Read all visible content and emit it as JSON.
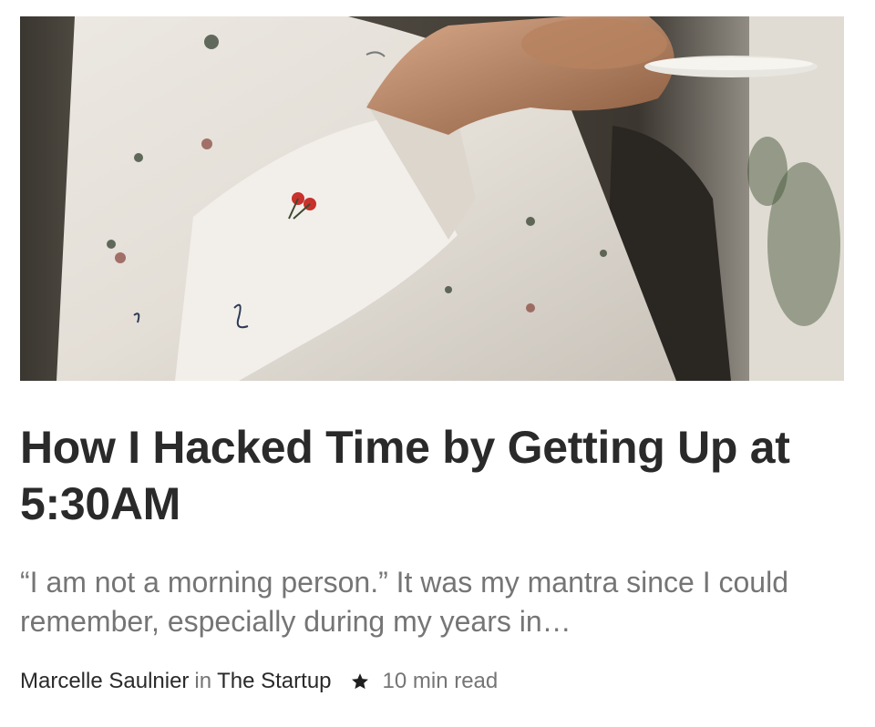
{
  "article": {
    "title": "How I Hacked Time by Getting Up at 5:30AM",
    "subtitle": "“I am not a morning person.” It was my mantra since I could remember, especially during my years in…",
    "author": "Marcelle Saulnier",
    "in_word": "in",
    "publication": "The Startup",
    "member_icon": "star-icon",
    "read_time": "10 min read"
  },
  "hero": {
    "icon": "photo-person-white-shirt-holding-saucer"
  },
  "colors": {
    "title": "#2a2a2a",
    "subtitle": "#757575",
    "byline_meta": "#757575"
  }
}
